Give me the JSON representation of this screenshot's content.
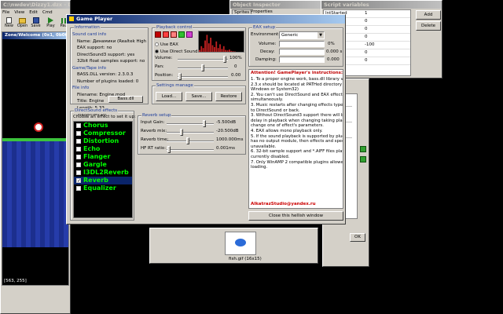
{
  "main_window": {
    "title": "C:\\nwdev\\Dizzy1.dzx - Dizzy Quest Editor 2",
    "menu": [
      "File",
      "View",
      "Edit",
      "Cmd",
      "Hlp",
      "Playback",
      "Misc"
    ],
    "toolbar": [
      "New",
      "Open",
      "Save",
      "Play",
      "Pau"
    ],
    "sub_title": "Zone/Welcome (0x1, 0b00...",
    "coords": "[563, 255]"
  },
  "object_inspector": {
    "title": "Object Inspector",
    "tabs": [
      "Sprites",
      "Properties"
    ]
  },
  "script_variables": {
    "title": "Script variables",
    "rows": [
      {
        "name": "IntStarted",
        "value": "1"
      },
      {
        "name": "",
        "value": "0"
      },
      {
        "name": "",
        "value": "0"
      },
      {
        "name": "",
        "value": "0"
      },
      {
        "name": "",
        "value": "-100"
      },
      {
        "name": "",
        "value": "0"
      },
      {
        "name": "",
        "value": "0"
      }
    ],
    "add_label": "Add",
    "delete_label": "Delete"
  },
  "image_window": {
    "title": "fish.gif (16x15)",
    "ok_label": "OK"
  },
  "game_player": {
    "title": "Game Player",
    "information": {
      "label": "Information",
      "sound_card_label": "Sound card info",
      "card_name": "Name: Динамики (Realtek High Definit",
      "eax": "EAX support: no",
      "directsound": "DirectSound3 support: yes",
      "sample_rate": "32bit float samples support: no",
      "game_title_label": "Game/Tape info",
      "bass_version": "BASS.DLL version: 2.3.0.3",
      "plugins": "Number of plugins loaded: 0",
      "file_info_label": "File info",
      "filename": "Filename: Engine.mod",
      "file_engine": "Title: Engine",
      "length": "Length: 5.33",
      "supported_by": "Supported by:",
      "bass_button": "Bass.dll"
    },
    "playback": {
      "label": "Playback control",
      "use_eax": "Use EAX",
      "use_direct_sound": "Use Direct Sound",
      "volume_label": "Volume:",
      "volume_value": "100%",
      "volume_level": 0.96,
      "pan_label": "Pan:",
      "pan_value": "0",
      "pan_level": 0.5,
      "position_label": "Position:",
      "position_value": "0.00",
      "position_level": 0.02
    },
    "settings": {
      "label": "Settings manage",
      "load": "Load...",
      "save": "Save...",
      "restore": "Restore"
    },
    "eax_setup": {
      "label": "EAX setup",
      "environment_label": "Environment:",
      "environment_value": "Generic",
      "volume_label": "Volume:",
      "volume_value": "0%",
      "decay_label": "Decay:",
      "decay_value": "0.000 s",
      "damping_label": "Damping:",
      "damping_value": "0.000"
    },
    "instructions": {
      "title": "Attention! GamePlayer's instructions:",
      "lines": [
        "1. To a proper engine work, bass.dll library version",
        "2.3.x should be located at PATHed directory (i.e.",
        "Windows or System32)",
        "2. You can't use DirectSound and EAX effects both",
        "simultaneously.",
        "3. Music restarts after changing effects type from EAX",
        "to DirectSound or back.",
        "3. Without DirectSound3 support there will be a short",
        "delay in playback when changing taking place if you",
        "change one of effect's parameters.",
        "4. EAX allows mono playback only.",
        "5. If the sound playback is supported by plugin, that",
        "has no output module, then effects and spectrum will be",
        "unavailable.",
        "6. 32-bit sample support and *.AIFF files playback are",
        "currently disabled.",
        "7. Only WinAMP 2 compatible plugins allowed for",
        "loading."
      ],
      "author": "AlkatrazStudio@yandex.ru",
      "close_label": "Close this hellish window"
    },
    "effects": {
      "label": "DirectSound effects",
      "hint": "Choose an effect to set it up:",
      "items": [
        {
          "name": "Chorus",
          "checked": false
        },
        {
          "name": "Compressor",
          "checked": false
        },
        {
          "name": "Distortion",
          "checked": false
        },
        {
          "name": "Echo",
          "checked": false
        },
        {
          "name": "Flanger",
          "checked": false
        },
        {
          "name": "Gargle",
          "checked": false
        },
        {
          "name": "I3DL2Reverb",
          "checked": false
        },
        {
          "name": "Reverb",
          "checked": true
        },
        {
          "name": "Equalizer",
          "checked": false
        }
      ],
      "checkmark": "✓"
    },
    "reverb": {
      "label": "Reverb setup",
      "params": [
        {
          "label": "Input Gain:",
          "value": "-5.500dB",
          "level": 0.82
        },
        {
          "label": "Reverb mix:",
          "value": "-20.500dB",
          "level": 0.3
        },
        {
          "label": "Reverb time:",
          "value": "1000.000ms",
          "level": 0.45
        },
        {
          "label": "HF RT ratio:",
          "value": "0.001ms",
          "level": 0.02
        }
      ]
    },
    "spectrum": [
      10,
      30,
      20,
      60,
      90,
      45,
      75,
      35,
      25,
      55,
      20,
      40,
      15,
      30,
      10,
      8,
      12,
      5,
      3,
      2,
      0,
      0,
      0,
      0
    ]
  },
  "colors": {
    "accent": "#0a246a",
    "effect_text": "#00ff00",
    "author": "#cc0000"
  }
}
